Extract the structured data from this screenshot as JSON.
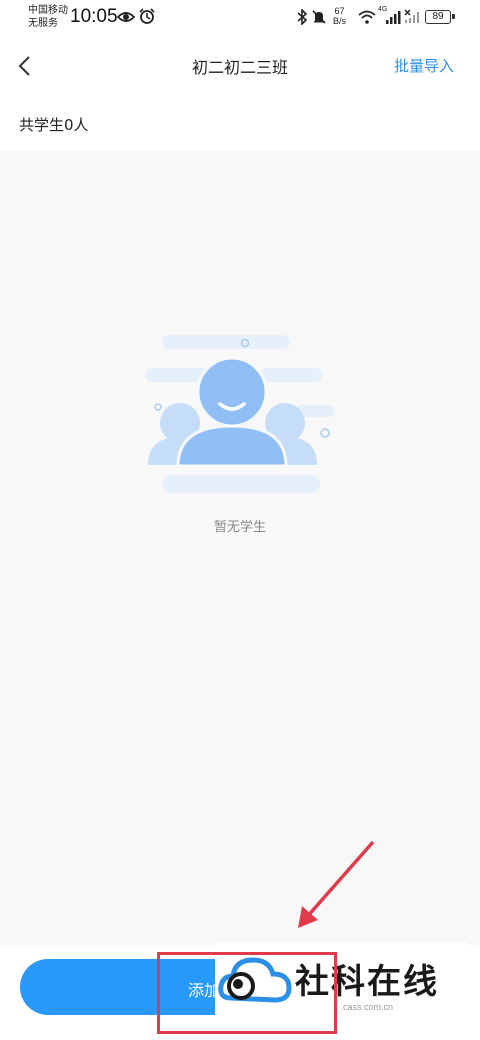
{
  "status_bar": {
    "carrier_line1": "中国移动",
    "carrier_line2": "无服务",
    "time": "10:05",
    "net_speed_value": "67",
    "net_speed_unit": "B/s",
    "network_type": "4G",
    "battery": "89"
  },
  "nav": {
    "title": "初二初二三班",
    "action": "批量导入"
  },
  "summary": {
    "count_text": "共学生0人"
  },
  "empty_state": {
    "text": "暂无学生"
  },
  "bottom": {
    "add_button_label": "添加"
  },
  "watermark": {
    "name": "社科在线",
    "domain": "cass.com.cn"
  },
  "colors": {
    "accent": "#2f8fe8",
    "button": "#2899f8",
    "highlight": "#e03a4b"
  }
}
